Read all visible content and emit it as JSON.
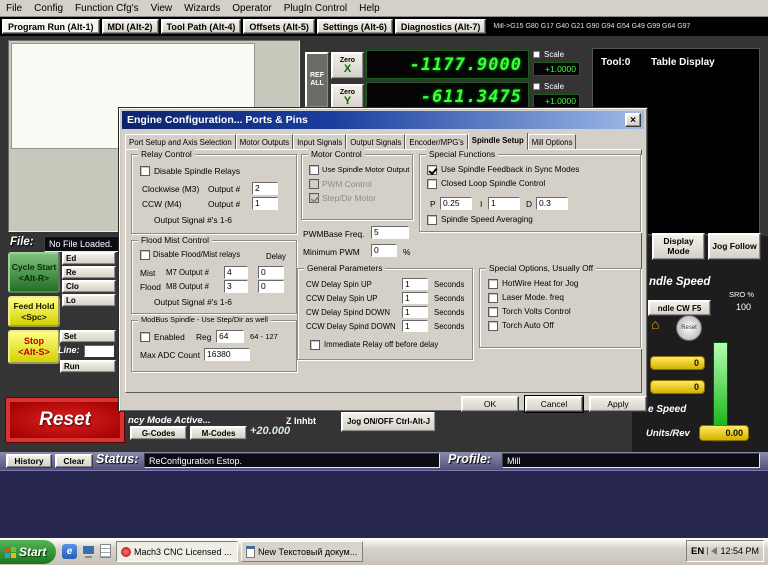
{
  "icons": {
    "close_glyph": "×",
    "home_glyph": "⌂",
    "ie_glyph": "e"
  },
  "window": {
    "menu": [
      "File",
      "Config",
      "Function Cfg's",
      "View",
      "Wizards",
      "Operator",
      "PlugIn Control",
      "Help"
    ]
  },
  "screens": {
    "tabs": [
      "Program Run (Alt-1)",
      "MDI (Alt-2)",
      "Tool Path (Alt-4)",
      "Offsets (Alt-5)",
      "Settings (Alt-6)",
      "Diagnostics (Alt-7)"
    ],
    "gcode_status": "Mill->G15 G80 G17 G40 G21 G90 G94 G54 G49 G99 G64 G97"
  },
  "dro": {
    "ref_all": "REF ALL",
    "x": {
      "zero": "Zero",
      "axis": "X",
      "value": "-1177.9000",
      "scale_label": "Scale",
      "scale": "+1.0000"
    },
    "y": {
      "zero": "Zero",
      "axis": "Y",
      "value": "-611.3475",
      "scale_label": "Scale",
      "scale": "+1.0000"
    }
  },
  "tool_panel": {
    "tool": "Tool:0",
    "mode": "Table Display"
  },
  "file_bar": {
    "label": "File:",
    "value": "No File Loaded."
  },
  "view_buttons": {
    "display_mode": "Display Mode",
    "jog_follow": "Jog Follow"
  },
  "run_controls": {
    "cycle_start": [
      "Cycle Start",
      "<Alt-R>"
    ],
    "feed_hold": [
      "Feed Hold",
      "<Spc>"
    ],
    "stop": [
      "Stop",
      "<Alt-S>"
    ],
    "side": [
      "Ed",
      "Re",
      "Clo",
      "Lo"
    ],
    "set": "Set",
    "line_label": "Line:",
    "line_value": "",
    "run": "Run",
    "reset": "Reset",
    "mode_text": "ncy Mode Active...",
    "z_inhbt": "Z Inhbt",
    "jog_toggle": "Jog ON/OFF Ctrl-Alt-J",
    "gcodes": "G-Codes",
    "mcodes": "M-Codes",
    "offset_value": "+20.000"
  },
  "spindle": {
    "header": "ndle Speed",
    "sro_label": "SRO %",
    "sro_value": "100",
    "cw_button": "ndle CW F5",
    "dial_label": "Reset",
    "rpm_value": "0",
    "sov_value": "0",
    "speed_label": "e Speed",
    "units_rev_label": "Units/Rev",
    "units_rev_value": "0.00"
  },
  "status_bar": {
    "history": "History",
    "clear": "Clear",
    "status_label": "Status:",
    "status_value": "ReConfiguration Estop.",
    "profile_label": "Profile:",
    "profile_value": "Mill"
  },
  "taskbar": {
    "start": "Start",
    "task1": "Mach3 CNC Licensed ...",
    "task2": "New Текстовый докум...",
    "lang": "EN",
    "time": "12:54 PM"
  },
  "dialog": {
    "title": "Engine Configuration... Ports & Pins",
    "tabs": [
      "Port Setup and Axis Selection",
      "Motor Outputs",
      "Input Signals",
      "Output Signals",
      "Encoder/MPG's",
      "Spindle Setup",
      "Mill Options"
    ],
    "relay": {
      "title": "Relay Control",
      "disable": "Disable Spindle Relays",
      "cw_label": "Clockwise (M3)",
      "output_label": "Output #",
      "cw_value": "2",
      "ccw_label": "CCW (M4)",
      "ccw_value": "1",
      "note": "Output Signal #'s 1-6"
    },
    "flood": {
      "title": "Flood Mist Control",
      "disable": "Disable Flood/Mist relays",
      "delay_label": "Delay",
      "mist_label": "Mist",
      "mist_output": "M7 Output #",
      "mist_value": "4",
      "mist_delay": "0",
      "flood_label": "Flood",
      "flood_output": "M8 Output #",
      "flood_value": "3",
      "flood_delay": "0",
      "note": "Output Signal #'s 1-6"
    },
    "modbus": {
      "title": "ModBus Spindle - Use Step/Dir as well",
      "enabled": "Enabled",
      "reg_label": "Reg",
      "reg_value": "64",
      "reg_range": "64 - 127",
      "adc_label": "Max ADC Count",
      "adc_value": "16380"
    },
    "motor": {
      "title": "Motor Control",
      "use_output": "Use Spindle Motor Output",
      "pwm": "PWM Control",
      "stepdir": "Step/Dir Motor",
      "pwmbase_label": "PWMBase Freq.",
      "pwmbase_value": "5",
      "minpwm_label": "Minimum PWM",
      "minpwm_value": "0",
      "percent": "%"
    },
    "general": {
      "title": "General Parameters",
      "rows": [
        {
          "label": "CW Delay Spin UP",
          "value": "1",
          "unit": "Seconds"
        },
        {
          "label": "CCW Delay Spin UP",
          "value": "1",
          "unit": "Seconds"
        },
        {
          "label": "CW Delay Spind DOWN",
          "value": "1",
          "unit": "Seconds"
        },
        {
          "label": "CCW Delay Spind DOWN",
          "value": "1",
          "unit": "Seconds"
        }
      ],
      "immediate": "Immediate Relay off before delay"
    },
    "special": {
      "title": "Special Functions",
      "feedback": "Use Spindle Feedback in Sync Modes",
      "closed_loop": "Closed Loop Spindle Control",
      "p_label": "P",
      "p": "0.25",
      "i_label": "I",
      "i": "1",
      "d_label": "D",
      "d": "0.3",
      "averaging": "Spindle Speed Averaging"
    },
    "options": {
      "title": "Special Options, Usually Off",
      "items": [
        "HotWire Heat for Jog",
        "Laser Mode. freq",
        "Torch Volts Control",
        "Torch Auto Off"
      ]
    },
    "buttons": {
      "ok": "OK",
      "cancel": "Cancel",
      "apply": "Apply"
    }
  }
}
